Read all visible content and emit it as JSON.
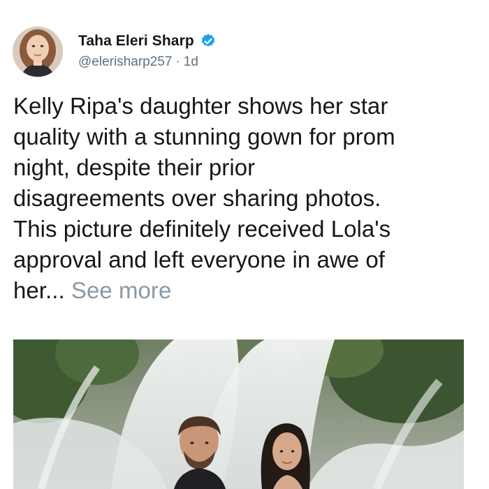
{
  "author": {
    "display_name": "Taha Eleri Sharp",
    "handle": "@elerisharp257",
    "separator": "·",
    "time_ago": "1d",
    "verified": true,
    "verified_icon": "verified-badge-icon",
    "verified_color": "#1da1f2"
  },
  "post": {
    "text": "Kelly Ripa's daughter shows her star\nquality with a stunning gown for prom\nnight, despite their prior\ndisagreements over sharing photos.\nThis picture definitely received Lola's\napproval and left everyone in awe of\nher... ",
    "see_more": "See more"
  },
  "colors": {
    "text": "#14171a",
    "secondary_text": "#5b7083",
    "see_more": "#8899a6"
  }
}
